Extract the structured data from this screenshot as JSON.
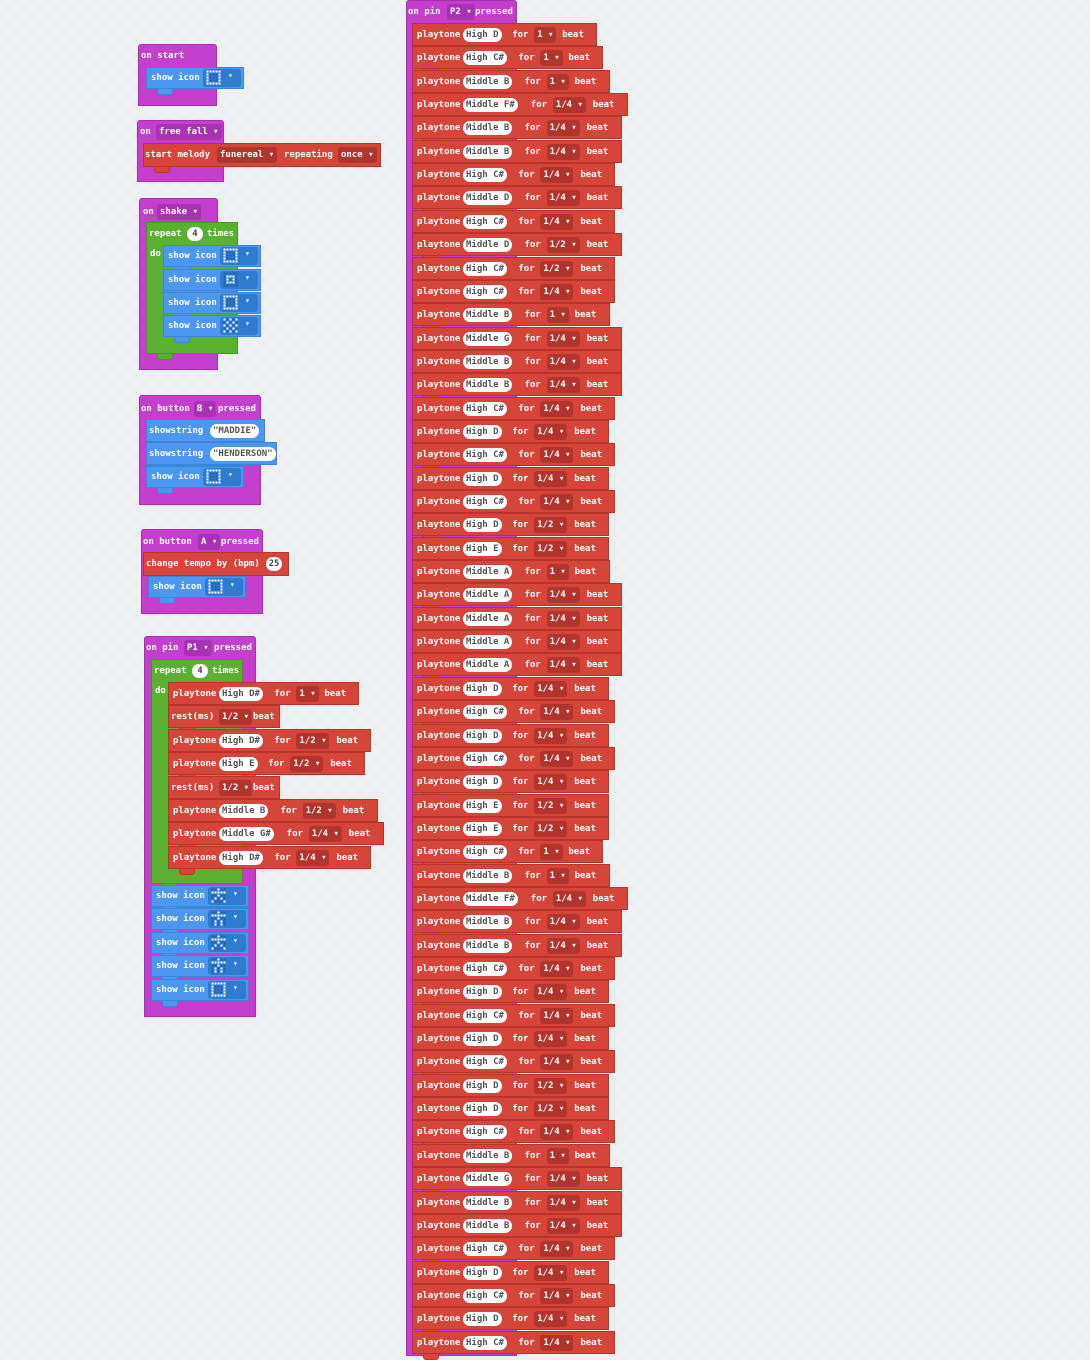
{
  "colors": {
    "background": "#ecf0f1",
    "events": "#c43fcd",
    "display": "#4c97ef",
    "music": "#d6453a",
    "loops": "#5ab031"
  },
  "icons": {
    "square": [
      ".#.#.#",
      "#....#",
      ".....",
      "#....#",
      ".#.#.#"
    ],
    "names": {
      "square": "square-icon",
      "small": "small-square-icon",
      "check": "checkerboard-icon",
      "person": "person-icon",
      "person2": "dancing-person-icon"
    }
  },
  "blocks": {
    "on_start": {
      "label": "on start",
      "show_icon": "show icon"
    },
    "free_fall": {
      "label": "on",
      "event": "free fall",
      "start_melody": "start melody",
      "melody": "funereal",
      "repeating": "repeating",
      "repeat_mode": "once"
    },
    "shake": {
      "label": "on",
      "event": "shake",
      "repeat": "repeat",
      "times": "4",
      "times_label": "times",
      "do": "do",
      "show_icon": "show icon"
    },
    "button_b": {
      "label": "on button",
      "button": "B",
      "pressed": "pressed",
      "showstring": "showstring",
      "str1": "\"MADDIE\"",
      "str2": "\"HENDERSON\"",
      "show_icon": "show icon"
    },
    "button_a": {
      "label": "on button",
      "button": "A",
      "pressed": "pressed",
      "change_tempo": "change tempo by (bpm)",
      "tempo": "25",
      "show_icon": "show icon"
    },
    "pin_p1": {
      "label": "on pin",
      "pin": "P1",
      "pressed": "pressed",
      "repeat": "repeat",
      "times": "4",
      "times_label": "times",
      "do": "do",
      "show_icon": "show icon",
      "tones": [
        {
          "kind": "tone",
          "note": "High D#",
          "dur": "1"
        },
        {
          "kind": "rest",
          "label": "rest(ms)",
          "dur": "1/2"
        },
        {
          "kind": "tone",
          "note": "High D#",
          "dur": "1/2"
        },
        {
          "kind": "tone",
          "note": "High E",
          "dur": "1/2"
        },
        {
          "kind": "rest",
          "label": "rest(ms)",
          "dur": "1/2"
        },
        {
          "kind": "tone",
          "note": "Middle B",
          "dur": "1/2"
        },
        {
          "kind": "tone",
          "note": "Middle G#",
          "dur": "1/4"
        },
        {
          "kind": "tone",
          "note": "High D#",
          "dur": "1/4"
        }
      ]
    },
    "pin_p2": {
      "label": "on pin",
      "pin": "P2",
      "pressed": "pressed",
      "tones": [
        {
          "note": "High D",
          "dur": "1"
        },
        {
          "note": "High C#",
          "dur": "1"
        },
        {
          "note": "Middle B",
          "dur": "1"
        },
        {
          "note": "Middle F#",
          "dur": "1/4"
        },
        {
          "note": "Middle B",
          "dur": "1/4"
        },
        {
          "note": "Middle B",
          "dur": "1/4"
        },
        {
          "note": "High C#",
          "dur": "1/4"
        },
        {
          "note": "Middle D",
          "dur": "1/4"
        },
        {
          "note": "High C#",
          "dur": "1/4"
        },
        {
          "note": "Middle D",
          "dur": "1/2"
        },
        {
          "note": "High C#",
          "dur": "1/2"
        },
        {
          "note": "High C#",
          "dur": "1/4"
        },
        {
          "note": "Middle B",
          "dur": "1"
        },
        {
          "note": "Middle G",
          "dur": "1/4"
        },
        {
          "note": "Middle B",
          "dur": "1/4"
        },
        {
          "note": "Middle B",
          "dur": "1/4"
        },
        {
          "note": "High C#",
          "dur": "1/4"
        },
        {
          "note": "High D",
          "dur": "1/4"
        },
        {
          "note": "High C#",
          "dur": "1/4"
        },
        {
          "note": "High D",
          "dur": "1/4"
        },
        {
          "note": "High C#",
          "dur": "1/4"
        },
        {
          "note": "High D",
          "dur": "1/2"
        },
        {
          "note": "High E",
          "dur": "1/2"
        },
        {
          "note": "Middle A",
          "dur": "1"
        },
        {
          "note": "Middle A",
          "dur": "1/4"
        },
        {
          "note": "Middle A",
          "dur": "1/4"
        },
        {
          "note": "Middle A",
          "dur": "1/4"
        },
        {
          "note": "Middle A",
          "dur": "1/4"
        },
        {
          "note": "High D",
          "dur": "1/4"
        },
        {
          "note": "High C#",
          "dur": "1/4"
        },
        {
          "note": "High D",
          "dur": "1/4"
        },
        {
          "note": "High C#",
          "dur": "1/4"
        },
        {
          "note": "High D",
          "dur": "1/4"
        },
        {
          "note": "High E",
          "dur": "1/2"
        },
        {
          "note": "High E",
          "dur": "1/2"
        },
        {
          "note": "High C#",
          "dur": "1"
        },
        {
          "note": "Middle B",
          "dur": "1"
        },
        {
          "note": "Middle F#",
          "dur": "1/4"
        },
        {
          "note": "Middle B",
          "dur": "1/4"
        },
        {
          "note": "Middle B",
          "dur": "1/4"
        },
        {
          "note": "High C#",
          "dur": "1/4"
        },
        {
          "note": "High D",
          "dur": "1/4"
        },
        {
          "note": "High C#",
          "dur": "1/4"
        },
        {
          "note": "High D",
          "dur": "1/4"
        },
        {
          "note": "High C#",
          "dur": "1/4"
        },
        {
          "note": "High D",
          "dur": "1/2"
        },
        {
          "note": "High D",
          "dur": "1/2"
        },
        {
          "note": "High C#",
          "dur": "1/4"
        },
        {
          "note": "Middle B",
          "dur": "1"
        },
        {
          "note": "Middle G",
          "dur": "1/4"
        },
        {
          "note": "Middle B",
          "dur": "1/4"
        },
        {
          "note": "Middle B",
          "dur": "1/4"
        },
        {
          "note": "High C#",
          "dur": "1/4"
        },
        {
          "note": "High D",
          "dur": "1/4"
        },
        {
          "note": "High C#",
          "dur": "1/4"
        },
        {
          "note": "High D",
          "dur": "1/4"
        },
        {
          "note": "High C#",
          "dur": "1/4"
        }
      ]
    },
    "tone_words": {
      "playtone": "playtone",
      "for": "for",
      "beat": "beat"
    }
  }
}
